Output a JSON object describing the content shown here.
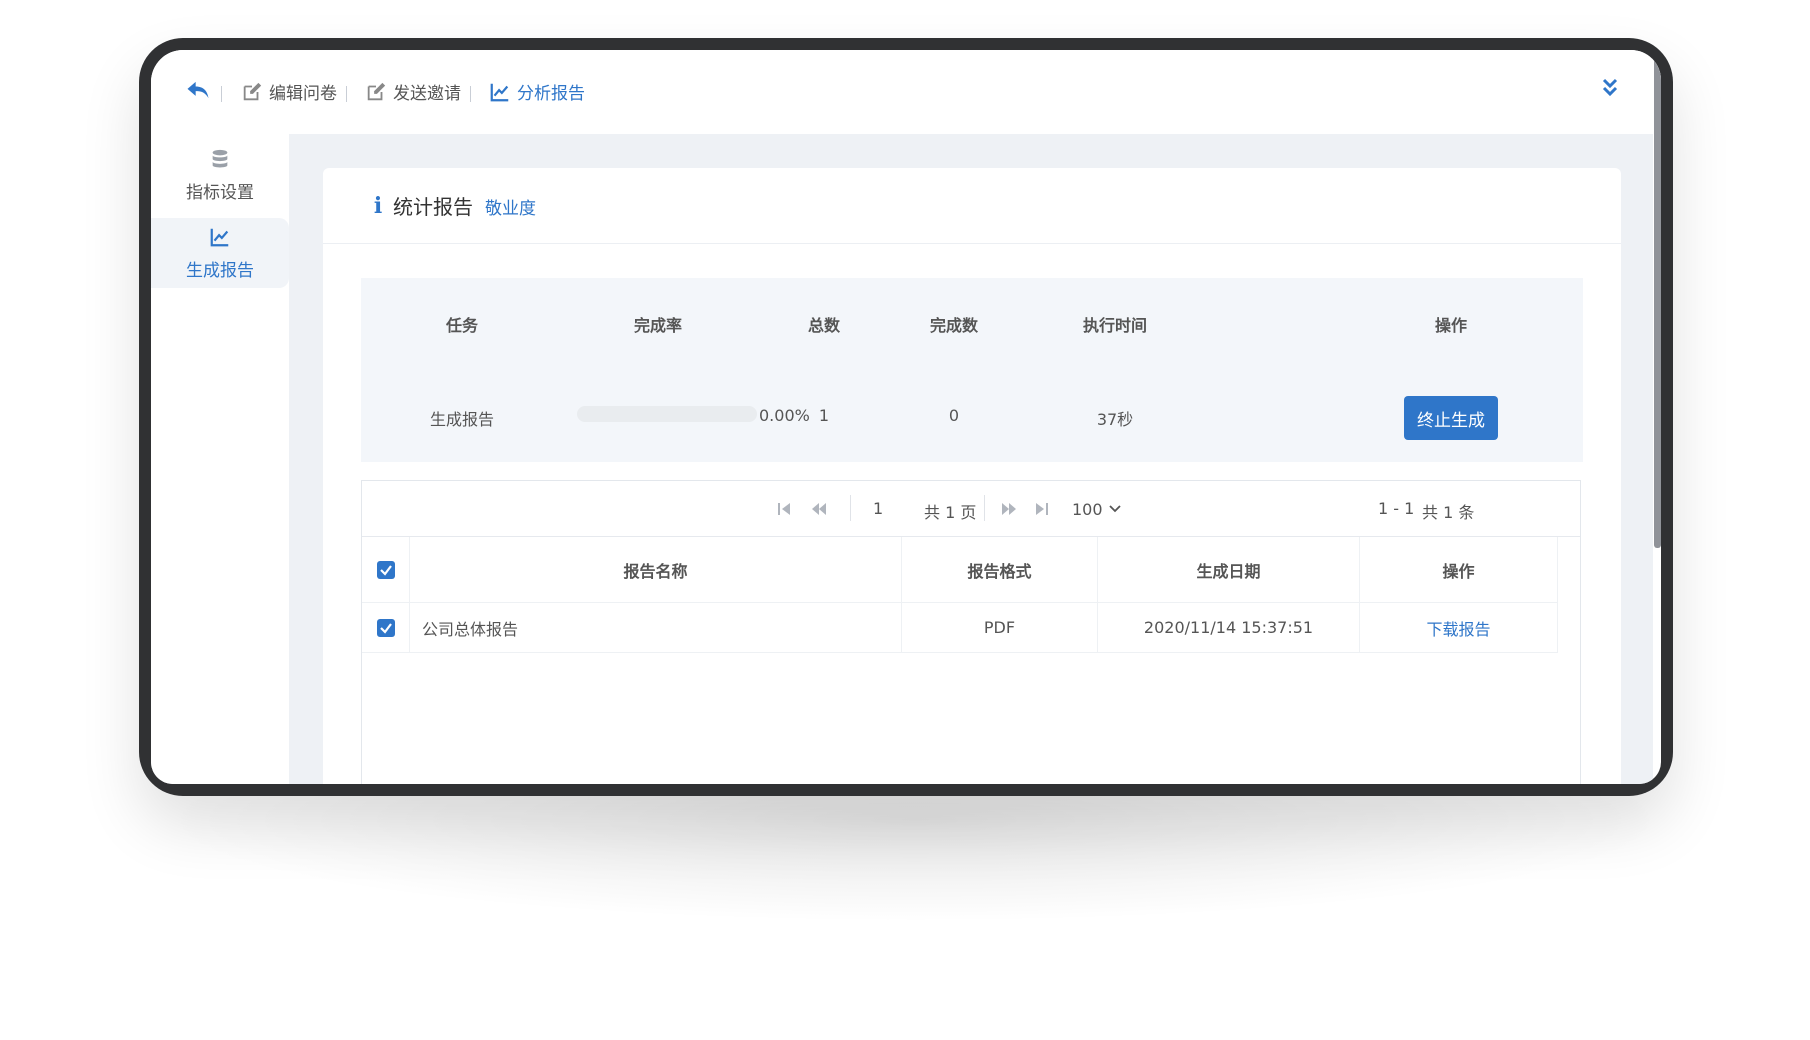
{
  "toolbar": {
    "items": [
      {
        "label": "编辑问卷",
        "icon": "edit-icon"
      },
      {
        "label": "发送邀请",
        "icon": "edit-icon"
      },
      {
        "label": "分析报告",
        "icon": "line-chart-icon"
      }
    ]
  },
  "sidebar": {
    "items": [
      {
        "label": "指标设置",
        "icon": "database-icon"
      },
      {
        "label": "生成报告",
        "icon": "line-chart-icon"
      }
    ]
  },
  "card": {
    "title": "统计报告",
    "subtitle": "敬业度"
  },
  "task": {
    "headers": [
      "任务",
      "完成率",
      "总数",
      "完成数",
      "执行时间",
      "操作"
    ],
    "row": {
      "name": "生成报告",
      "progress": 0.0,
      "rate": "0.00%",
      "total": "1",
      "done": "0",
      "time": "37秒",
      "action": "终止生成"
    }
  },
  "pager": {
    "current_page": "1",
    "total_pages": "共 1 页",
    "page_size": "100",
    "range": "1 - 1",
    "total_count": "共 1 条"
  },
  "reports": {
    "headers": [
      "报告名称",
      "报告格式",
      "生成日期",
      "操作"
    ],
    "rows": [
      {
        "name": "公司总体报告",
        "format": "PDF",
        "date": "2020/11/14 15:37:51",
        "action": "下载报告",
        "checked": true
      }
    ],
    "header_checked": true
  },
  "colors": {
    "accent": "#2f76c9",
    "frame": "#303133",
    "panel": "#f3f6fa"
  }
}
